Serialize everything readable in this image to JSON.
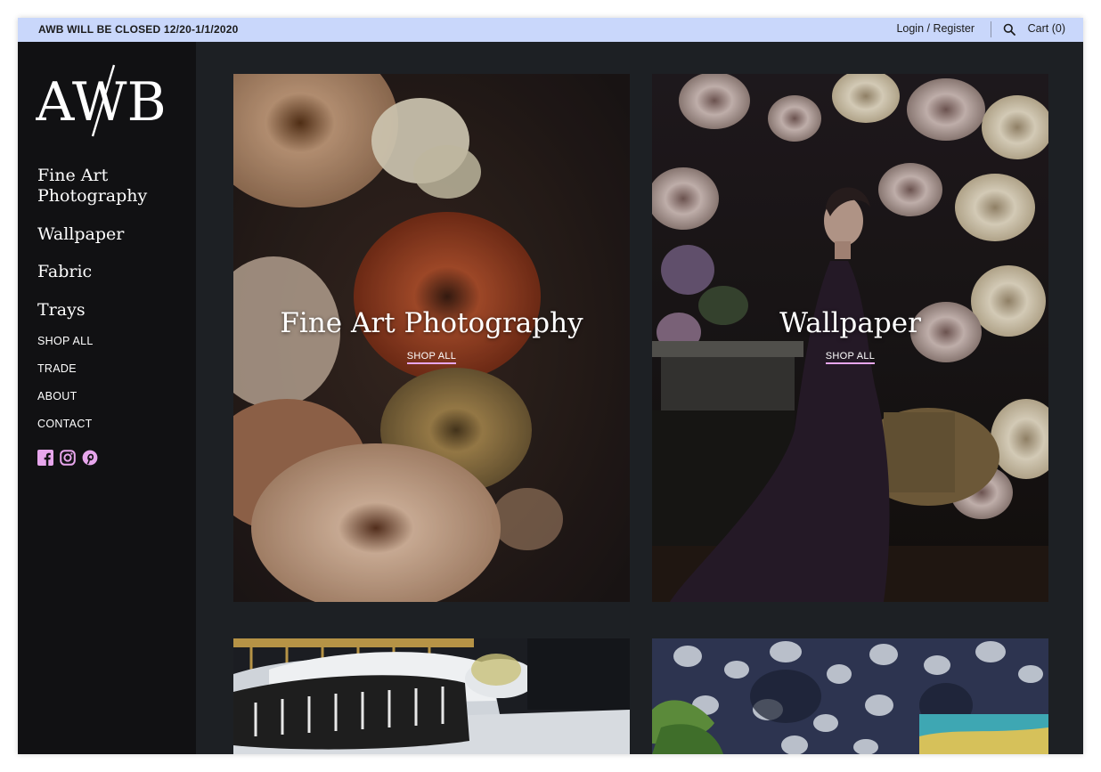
{
  "topbar": {
    "announcement": "AWB WILL BE CLOSED 12/20-1/1/2020",
    "login_label": "Login / Register",
    "search_icon": "search-icon",
    "cart_label": "Cart (0)"
  },
  "sidebar": {
    "logo_text": "AWB",
    "main_nav": [
      {
        "label": "Fine Art Photography"
      },
      {
        "label": "Wallpaper"
      },
      {
        "label": "Fabric"
      },
      {
        "label": "Trays"
      }
    ],
    "secondary_nav": [
      {
        "label": "SHOP ALL"
      },
      {
        "label": "TRADE"
      },
      {
        "label": "ABOUT"
      },
      {
        "label": "CONTACT"
      }
    ],
    "social_icons": [
      "facebook-icon",
      "instagram-icon",
      "pinterest-icon"
    ]
  },
  "tiles": [
    {
      "title": "Fine Art Photography",
      "link": "SHOP ALL"
    },
    {
      "title": "Wallpaper",
      "link": "SHOP ALL"
    },
    {
      "title": "",
      "link": ""
    },
    {
      "title": "",
      "link": ""
    }
  ],
  "colors": {
    "topbar_bg": "#c9d7fb",
    "sidebar_bg": "#111113",
    "main_bg": "#1d2024",
    "accent_pink": "#e7a6ec"
  }
}
